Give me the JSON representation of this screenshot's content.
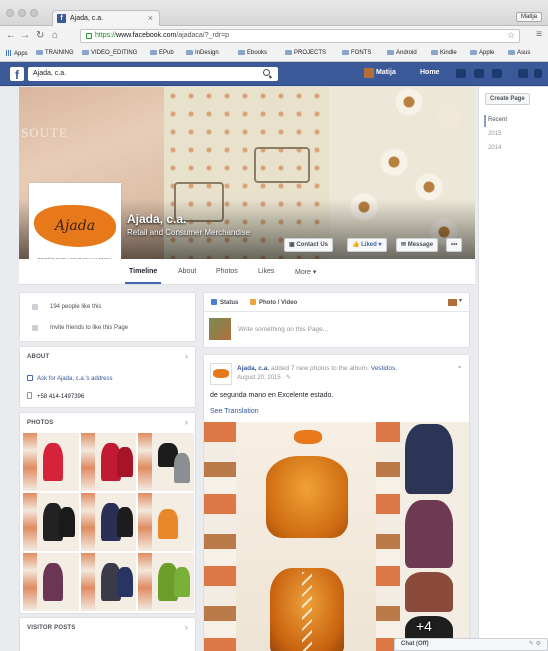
{
  "browser": {
    "tab_title": "Ajada, c.a.",
    "tab_close": "×",
    "profile_name": "Matija",
    "url_scheme": "https://",
    "url_host": "www.facebook.com",
    "url_path": "/ajadaca/?_rdr=p",
    "bookmarks": [
      "Apps",
      "TRAINING",
      "VIDEO_EDITING",
      "EPub",
      "InDesign",
      "Ebooks",
      "PROJECTS",
      "FONTS",
      "Android",
      "Kindle",
      "Apple",
      "Asus"
    ]
  },
  "facebook_bar": {
    "search_value": "Ajada, c.a.",
    "user_name": "Matija",
    "home_label": "Home"
  },
  "page_header": {
    "page_name": "Ajada, c.a.",
    "category": "Retail and Consumer Merchandise",
    "logo_text": "Ajada",
    "logo_subtitle": "DISEÑO EXCLUSIVO EN VALENCIA",
    "buttons": {
      "contact": "Contact Us",
      "liked": "Liked ▾",
      "message": "Message",
      "more": "•••"
    },
    "tabs": [
      "Timeline",
      "About",
      "Photos",
      "Likes",
      "More ▾"
    ]
  },
  "right_rail": {
    "create_page": "Create Page",
    "years": [
      "Recent",
      "2015",
      "2014"
    ]
  },
  "left_column": {
    "likes_count_text": "194 people like this",
    "invite_text": "Invite friends to like this Page",
    "about_title": "ABOUT",
    "about_address_link": "Ask for Ajada, c.a.'s address",
    "about_phone": "+58 414-1497396",
    "photos_title": "PHOTOS",
    "visitor_posts_title": "VISITOR POSTS",
    "chevron": "›"
  },
  "composer": {
    "status_label": "Status",
    "photo_video_label": "Photo / Video",
    "placeholder": "Write something on this Page..."
  },
  "post": {
    "author": "Ajada, c.a.",
    "action": "added 7 new photos to the album:",
    "album": "Vestidos.",
    "time": "August 20, 2015 · ✎",
    "text": "de segunda mano en Excelente estado.",
    "see_translation": "See Translation",
    "extra_photos": "+4",
    "menu": "⌄"
  },
  "chat": {
    "label": "Chat (Off)",
    "controls": "✎ ⚙"
  },
  "colors": {
    "facebook_blue": "#3b5998",
    "link_blue": "#365899",
    "brand_orange": "#e8791b"
  }
}
